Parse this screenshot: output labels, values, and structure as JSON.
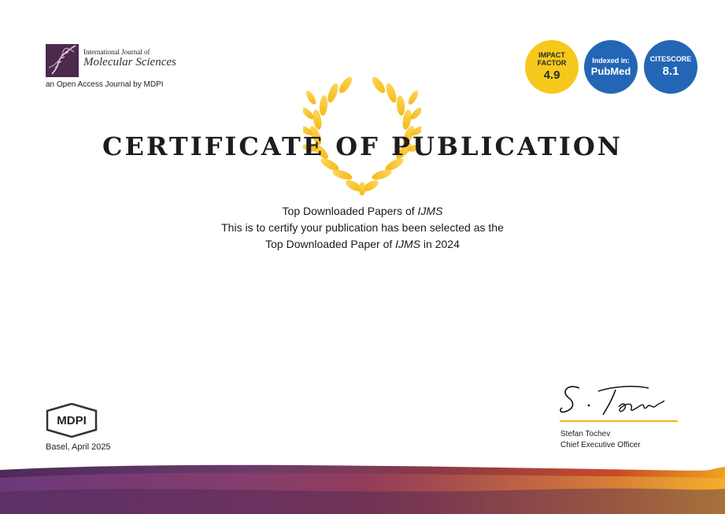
{
  "journal": {
    "name_line1": "International Journal of",
    "name_line2": "Molecular Sciences",
    "tagline": "an Open Access Journal by MDPI"
  },
  "badges": {
    "impact_label": "IMPACT FACTOR",
    "impact_value": "4.9",
    "pubmed_label": "Indexed in:",
    "pubmed_value": "PubMed",
    "citescore_label": "CITESCORE",
    "citescore_value": "8.1"
  },
  "certificate": {
    "title": "CERTIFICATE OF PUBLICATION",
    "line1_prefix": "Top Downloaded Papers of ",
    "line1_em": "IJMS",
    "line2": "This is to certify your publication has been selected as the",
    "line3_prefix": "Top Downloaded Paper of ",
    "line3_em": "IJMS",
    "line3_suffix": " in 2024"
  },
  "publisher": {
    "logo_text": "MDPI",
    "place_date": "Basel, April 2025"
  },
  "signatory": {
    "signature_text": "S. Tochev",
    "name": "Stefan Tochev",
    "title": "Chief Executive Officer"
  },
  "colors": {
    "gold": "#f6c81b",
    "blue": "#2366b6",
    "purple": "#4b2a4d"
  }
}
